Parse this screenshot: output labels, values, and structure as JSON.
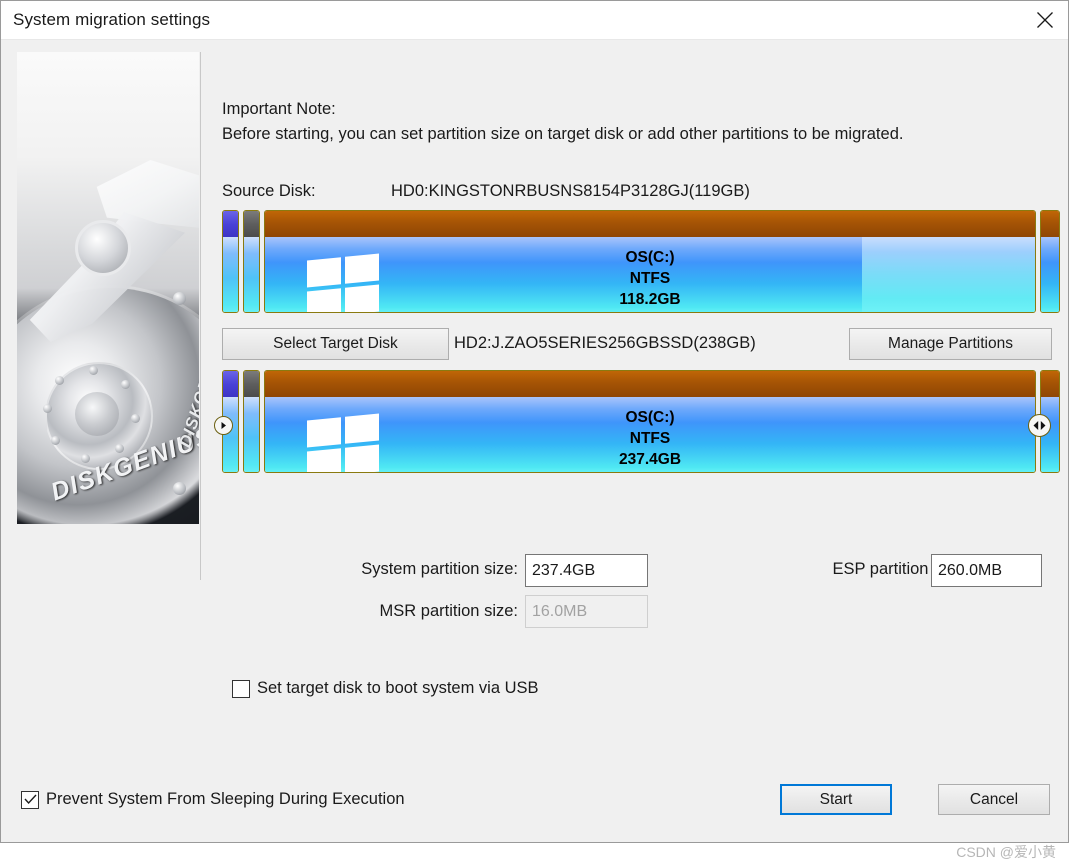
{
  "window": {
    "title": "System migration settings",
    "close_icon": "close-icon"
  },
  "note": {
    "title": "Important Note:",
    "body": "Before starting, you can set partition size on target disk or add other partitions to be migrated."
  },
  "source": {
    "label": "Source Disk:",
    "value": "HD0:KINGSTONRBUSNS8154P3128GJ(119GB)",
    "partitions": [
      {
        "name": "",
        "fs": "",
        "size": "",
        "kind": "esp"
      },
      {
        "name": "",
        "fs": "",
        "size": "",
        "kind": "msr"
      },
      {
        "name": "OS(C:)",
        "fs": "NTFS",
        "size": "118.2GB",
        "kind": "os"
      },
      {
        "name": "",
        "fs": "",
        "size": "",
        "kind": "recovery"
      }
    ]
  },
  "target": {
    "select_button": "Select Target Disk",
    "value": "HD2:J.ZAO5SERIES256GBSSD(238GB)",
    "manage_button": "Manage Partitions",
    "partitions": [
      {
        "name": "",
        "fs": "",
        "size": "",
        "kind": "esp"
      },
      {
        "name": "",
        "fs": "",
        "size": "",
        "kind": "msr"
      },
      {
        "name": "OS(C:)",
        "fs": "NTFS",
        "size": "237.4GB",
        "kind": "os"
      },
      {
        "name": "",
        "fs": "",
        "size": "",
        "kind": "recovery"
      }
    ],
    "handle_left_icon": "drag-handle-right-arrow-icon",
    "handle_right_icon": "drag-handle-resize-icon"
  },
  "fields": {
    "system_partition_label": "System partition size:",
    "system_partition_value": "237.4GB",
    "msr_partition_label": "MSR partition size:",
    "msr_partition_value": "16.0MB",
    "esp_partition_label": "ESP partition size:",
    "esp_partition_value": "260.0MB"
  },
  "options": {
    "usb_boot_label": "Set target disk to boot system via USB",
    "usb_boot_checked": false,
    "prevent_sleep_label": "Prevent System From Sleeping During Execution",
    "prevent_sleep_checked": true
  },
  "footer": {
    "start_label": "Start",
    "cancel_label": "Cancel"
  },
  "watermark": "CSDN @爱小黄",
  "colors": {
    "accent": "#0078d7",
    "partition_used_header": "#a55405",
    "partition_blue_header": "#4a42d8",
    "partition_gray_header": "#5e5e5e",
    "partition_body": "#3f95fb",
    "window_bg": "#f0f0f0"
  },
  "branding": {
    "logo_text": "DISKGENIUS",
    "logo_text_2": "DISKGENIUS"
  }
}
